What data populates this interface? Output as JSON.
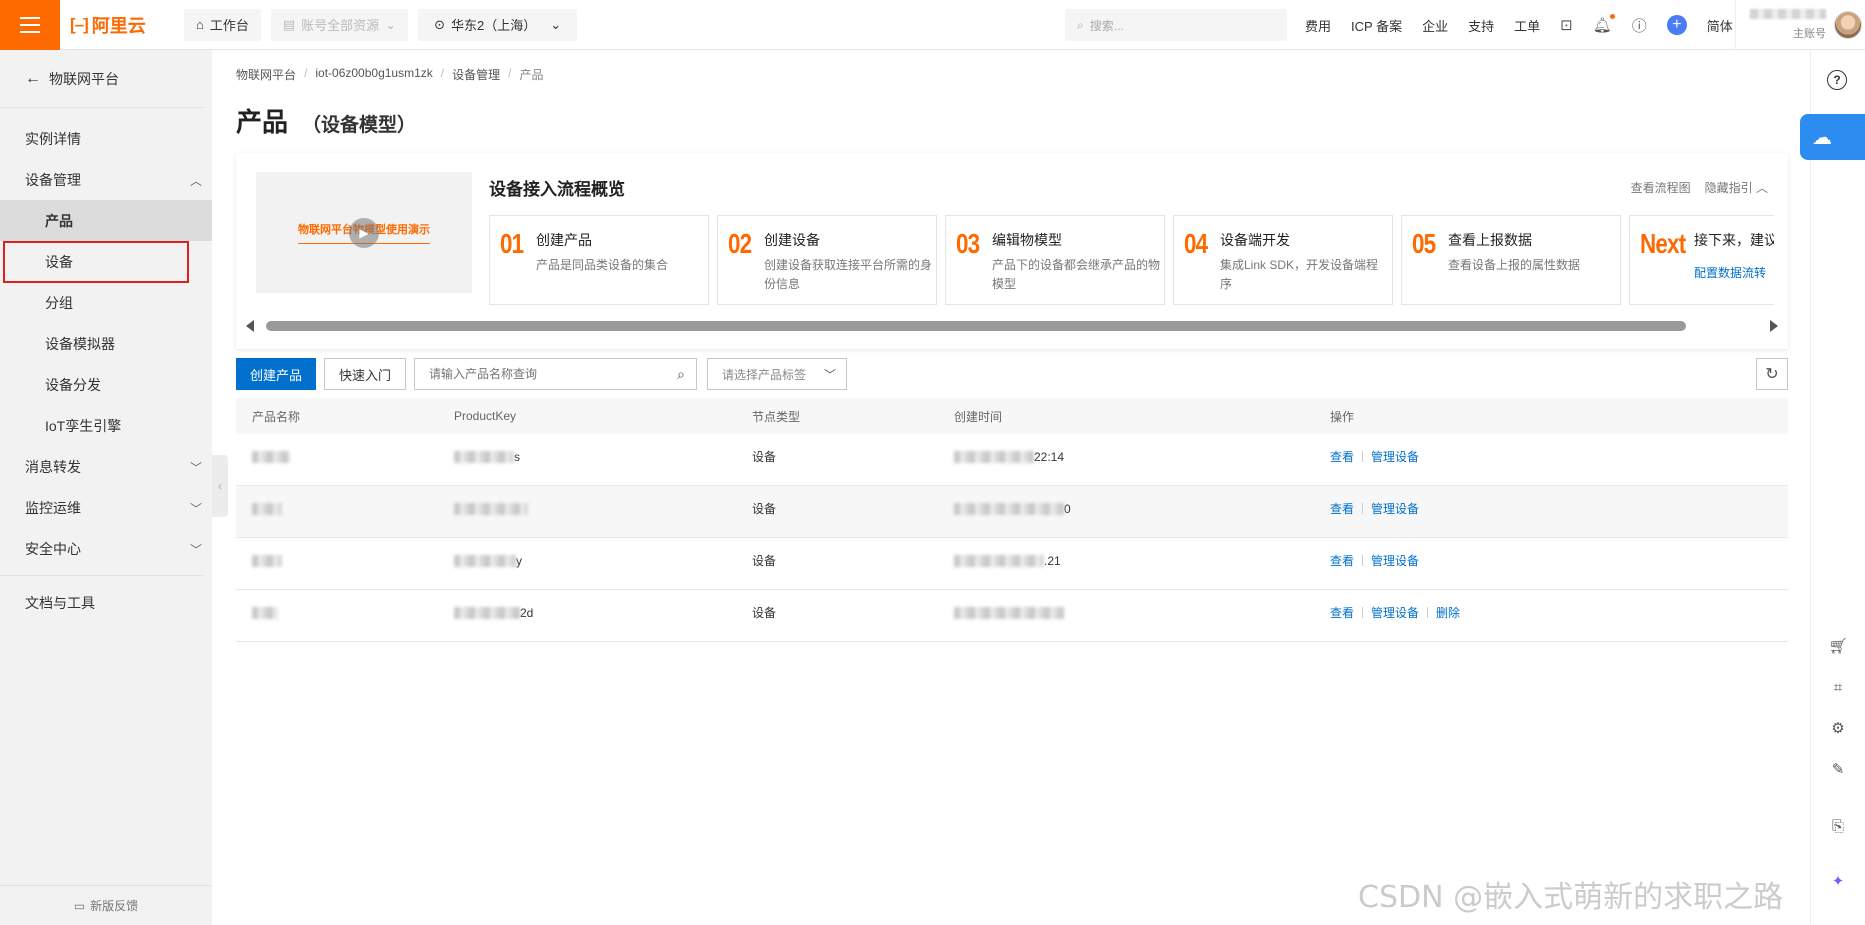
{
  "topbar": {
    "logo_text": "阿里云",
    "workbench": "工作台",
    "resources": "账号全部资源",
    "region": "华东2（上海）",
    "search_placeholder": "搜索...",
    "links": [
      "费用",
      "ICP 备案",
      "企业",
      "支持",
      "工单"
    ],
    "language": "简体",
    "account_sub": "主账号"
  },
  "sidebar": {
    "back": "物联网平台",
    "items": [
      {
        "label": "实例详情"
      },
      {
        "label": "设备管理"
      },
      {
        "label": "产品"
      },
      {
        "label": "设备"
      },
      {
        "label": "分组"
      },
      {
        "label": "设备模拟器"
      },
      {
        "label": "设备分发"
      },
      {
        "label": "IoT孪生引擎"
      },
      {
        "label": "消息转发"
      },
      {
        "label": "监控运维"
      },
      {
        "label": "安全中心"
      },
      {
        "label": "文档与工具"
      }
    ],
    "feedback": "新版反馈"
  },
  "breadcrumb": [
    "物联网平台",
    "iot-06z00b0g1usm1zk",
    "设备管理",
    "产品"
  ],
  "page": {
    "title": "产品",
    "subtitle": "（设备模型）"
  },
  "guide": {
    "video_title": "物联网平台物模型使用演示",
    "title": "设备接入流程概览",
    "view_flow": "查看流程图",
    "hide_guide": "隐藏指引",
    "steps": [
      {
        "num": "01",
        "name": "创建产品",
        "desc": "产品是同品类设备的集合"
      },
      {
        "num": "02",
        "name": "创建设备",
        "desc": "创建设备获取连接平台所需的身份信息"
      },
      {
        "num": "03",
        "name": "编辑物模型",
        "desc": "产品下的设备都会继承产品的物模型"
      },
      {
        "num": "04",
        "name": "设备端开发",
        "desc": "集成Link SDK，开发设备端程序"
      },
      {
        "num": "05",
        "name": "查看上报数据",
        "desc": "查看设备上报的属性数据"
      },
      {
        "num": "Next",
        "name": "接下来，建议您",
        "link": "配置数据流转"
      }
    ]
  },
  "toolbar": {
    "create": "创建产品",
    "quick_start": "快速入门",
    "search_placeholder": "请输入产品名称查询",
    "tag_placeholder": "请选择产品标签"
  },
  "table": {
    "columns": [
      "产品名称",
      "ProductKey",
      "节点类型",
      "创建时间",
      "操作"
    ],
    "rows": [
      {
        "node": "设备",
        "key_suffix": "s",
        "time_suffix": "22:14",
        "ops": [
          "查看",
          "管理设备"
        ]
      },
      {
        "node": "设备",
        "key_suffix": "",
        "time_suffix": "0",
        "ops": [
          "查看",
          "管理设备"
        ]
      },
      {
        "node": "设备",
        "key_suffix": "y",
        "time_suffix": ".21",
        "ops": [
          "查看",
          "管理设备"
        ]
      },
      {
        "node": "设备",
        "key_suffix": "2d",
        "time_suffix": "",
        "ops": [
          "查看",
          "管理设备",
          "删除"
        ]
      }
    ]
  },
  "watermark": "CSDN @嵌入式萌新的求职之路"
}
